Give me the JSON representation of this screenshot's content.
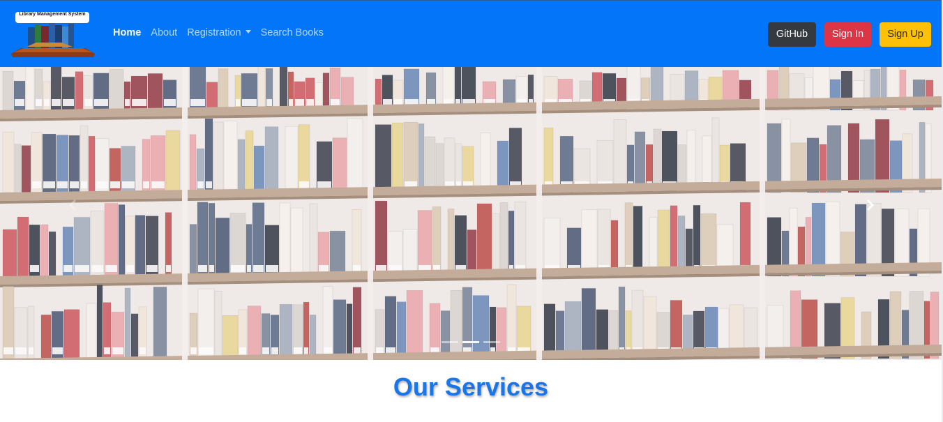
{
  "navbar": {
    "logo_text": "Library Management System",
    "links": [
      {
        "label": "Home",
        "active": true
      },
      {
        "label": "About"
      },
      {
        "label": "Registration",
        "dropdown": true
      },
      {
        "label": "Search Books"
      }
    ],
    "buttons": {
      "github": "GitHub",
      "signin": "Sign In",
      "signup": "Sign Up"
    },
    "colors": {
      "bar": "#0275f8",
      "github": "#343a40",
      "signin": "#dc3545",
      "signup": "#ffc107"
    }
  },
  "carousel": {
    "image": "bookshelf-photo",
    "controls": {
      "next": "chevron-right-icon",
      "prev": "chevron-left-icon"
    },
    "indicators": [
      {
        "active": false
      },
      {
        "active": true
      },
      {
        "active": false
      }
    ]
  },
  "services": {
    "title": "Our Services",
    "color": "#1a76e8"
  }
}
